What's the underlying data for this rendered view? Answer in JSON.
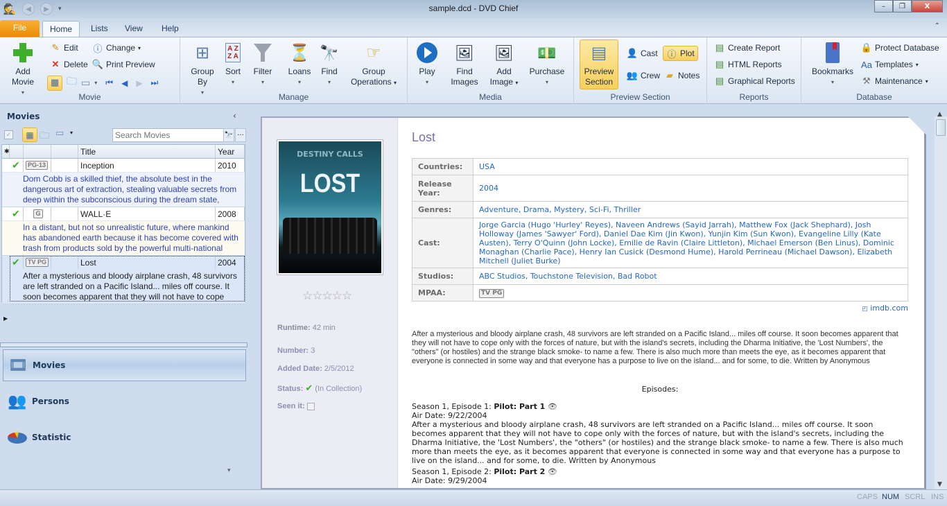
{
  "window": {
    "title": "sample.dcd - DVD Chief",
    "controls": {
      "minimize": "–",
      "restore": "❐",
      "close": "X"
    }
  },
  "tabs": [
    {
      "label": "File"
    },
    {
      "label": "Home"
    },
    {
      "label": "Lists"
    },
    {
      "label": "View"
    },
    {
      "label": "Help"
    }
  ],
  "ribbon": {
    "movie": {
      "label": "Movie",
      "add_movie": "Add Movie",
      "edit": "Edit",
      "delete": "Delete",
      "change": "Change",
      "print_preview": "Print Preview"
    },
    "manage": {
      "label": "Manage",
      "group_by": "Group By",
      "sort": "Sort",
      "filter": "Filter",
      "loans": "Loans",
      "find": "Find",
      "group_operations": "Group Operations"
    },
    "media": {
      "label": "Media",
      "play": "Play",
      "find_images": "Find Images",
      "add_image": "Add Image",
      "purchase": "Purchase"
    },
    "preview": {
      "label": "Preview Section",
      "preview_section": "Preview Section",
      "cast": "Cast",
      "plot": "Plot",
      "crew": "Crew",
      "notes": "Notes"
    },
    "reports": {
      "label": "Reports",
      "create_report": "Create Report",
      "html_reports": "HTML Reports",
      "graphical_reports": "Graphical Reports"
    },
    "database": {
      "label": "Database",
      "bookmarks": "Bookmarks",
      "protect_database": "Protect Database",
      "templates": "Templates",
      "maintenance": "Maintenance"
    }
  },
  "left_panel": {
    "title": "Movies",
    "search_placeholder": "Search Movies",
    "columns": {
      "title": "Title",
      "year": "Year"
    },
    "movies": [
      {
        "rating": "PG-13",
        "title": "Inception",
        "year": "2010",
        "desc": "Dom Cobb is a skilled thief, the absolute best in the dangerous art of extraction, stealing valuable secrets from deep within the subconscious during the dream state,"
      },
      {
        "rating": "G",
        "title": "WALL·E",
        "year": "2008",
        "desc": "In a distant, but not so unrealistic future, where mankind has abandoned earth because it has become covered with trash from products sold by the powerful multi-national"
      },
      {
        "rating": "TV PG",
        "title": "Lost",
        "year": "2004",
        "desc": "After a mysterious and bloody airplane crash, 48 survivors are left stranded on a Pacific Island... miles off course. It soon becomes apparent that they will not have to cope"
      }
    ],
    "nav": [
      {
        "label": "Movies"
      },
      {
        "label": "Persons"
      },
      {
        "label": "Statistic"
      }
    ]
  },
  "detail": {
    "poster": {
      "tagline": "DESTINY CALLS",
      "title": "LOST"
    },
    "rating_stars": 0,
    "rating_max": 5,
    "runtime_label": "Runtime:",
    "runtime": "42 min",
    "number_label": "Number:",
    "number": "3",
    "added_label": "Added Date:",
    "added": "2/5/2012",
    "status_label": "Status:",
    "status": "(In Collection)",
    "seen_label": "Seen it:",
    "title": "Lost",
    "info": [
      {
        "key": "Countries:",
        "value": "USA"
      },
      {
        "key": "Release Year:",
        "value": "2004"
      },
      {
        "key": "Genres:",
        "value": "Adventure, Drama, Mystery, Sci-Fi, Thriller"
      },
      {
        "key": "Cast:",
        "value": "Jorge Garcia (Hugo 'Hurley' Reyes), Naveen Andrews (Sayid Jarrah), Matthew Fox (Jack Shephard), Josh Holloway (James 'Sawyer' Ford), Daniel Dae Kim (Jin Kwon), Yunjin Kim (Sun Kwon), Evangeline Lilly (Kate Austen), Terry O'Quinn (John Locke), Emilie de Ravin (Claire Littleton), Michael Emerson (Ben Linus), Dominic Monaghan (Charlie Pace), Henry Ian Cusick (Desmond Hume), Harold Perrineau (Michael Dawson), Elizabeth Mitchell (Juliet Burke)"
      },
      {
        "key": "Studios:",
        "value": "ABC Studios, Touchstone Television, Bad Robot"
      },
      {
        "key": "MPAA:",
        "value": "TV PG"
      }
    ],
    "imdb": "imdb.com",
    "plot": "After a mysterious and bloody airplane crash, 48 survivors are left stranded on a Pacific Island... miles off course. It soon becomes apparent that they will not have to cope only with the forces of nature, but with the island's secrets, including the Dharma Initiative, the 'Lost Numbers', the \"others\" (or hostiles) and the strange black smoke- to name a few. There is also much more than meets the eye, as it becomes apparent that everyone is connected in some way and that everyone has a purpose to live on the island... and for some, to die. Written by Anonymous",
    "episodes_label": "Episodes:",
    "episodes": [
      {
        "prefix": "Season 1, Episode 1:",
        "name": "Pilot: Part 1",
        "air": "Air Date: 9/22/2004",
        "desc": "After a mysterious and bloody airplane crash, 48 survivors are left stranded on a Pacific Island... miles off course. It soon becomes apparent that they will not have to cope only with the forces of nature, but with the island's secrets, including the Dharma Initiative, the 'Lost Numbers', the \"others\" (or hostiles) and the strange black smoke- to name a few. There is also much more than meets the eye, as it becomes apparent that everyone is connected in some way and that everyone has a purpose to live on the island... and for some, to die. Written by Anonymous"
      },
      {
        "prefix": "Season 1, Episode 2:",
        "name": "Pilot: Part 2",
        "air": "Air Date: 9/29/2004",
        "desc": ""
      }
    ]
  },
  "statusbar": {
    "caps": "CAPS",
    "num": "NUM",
    "scrl": "SCRL",
    "ins": "INS"
  }
}
